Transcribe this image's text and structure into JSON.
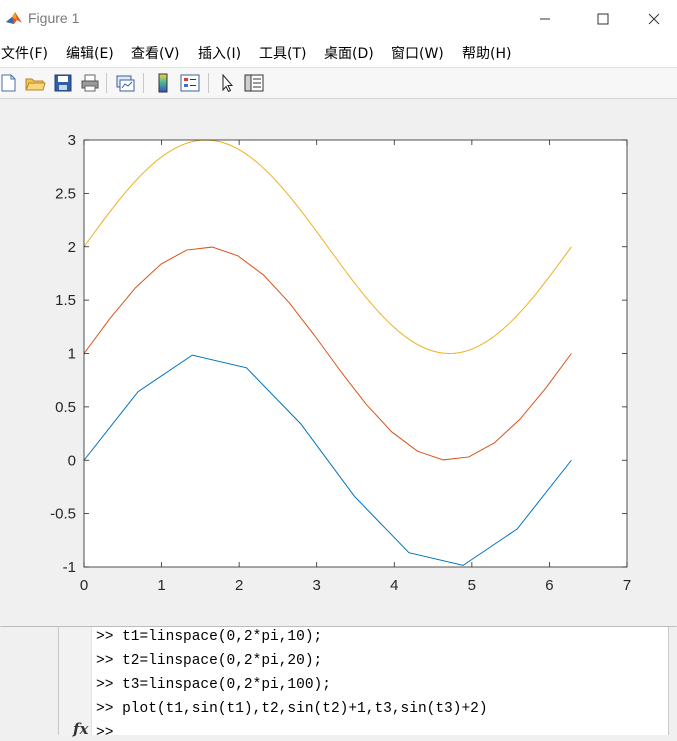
{
  "window": {
    "title": "Figure 1",
    "minimize_glyph": "—",
    "maximize_glyph": "☐",
    "close_glyph": "✕"
  },
  "menu": {
    "items": [
      {
        "label": "文件(F)"
      },
      {
        "label": "编辑(E)"
      },
      {
        "label": "查看(V)"
      },
      {
        "label": "插入(I)"
      },
      {
        "label": "工具(T)"
      },
      {
        "label": "桌面(D)"
      },
      {
        "label": "窗口(W)"
      },
      {
        "label": "帮助(H)"
      }
    ]
  },
  "toolbar": {
    "icons": [
      "new-figure-icon",
      "open-file-icon",
      "save-icon",
      "print-icon",
      "link-plot-icon",
      "insert-colorbar-icon",
      "insert-legend-icon",
      "edit-plot-pointer-icon",
      "property-inspector-icon"
    ]
  },
  "chart_data": {
    "type": "line",
    "xlim": [
      0,
      7
    ],
    "ylim": [
      -1,
      3
    ],
    "xticks": [
      0,
      1,
      2,
      3,
      4,
      5,
      6,
      7
    ],
    "yticks": [
      -1,
      -0.5,
      0,
      0.5,
      1,
      1.5,
      2,
      2.5,
      3
    ],
    "xtick_labels": [
      "0",
      "1",
      "2",
      "3",
      "4",
      "5",
      "6",
      "7"
    ],
    "ytick_labels": [
      "-1",
      "-0.5",
      "0",
      "0.5",
      "1",
      "1.5",
      "2",
      "2.5",
      "3"
    ],
    "grid": false,
    "series": [
      {
        "color": "#0072BD",
        "x": [
          0,
          0.698,
          1.396,
          2.094,
          2.793,
          3.491,
          4.189,
          4.887,
          5.585,
          6.283
        ],
        "y": [
          0,
          0.643,
          0.985,
          0.866,
          0.342,
          -0.342,
          -0.866,
          -0.985,
          -0.643,
          0
        ]
      },
      {
        "color": "#D95319",
        "x": [
          0,
          0.331,
          0.661,
          0.992,
          1.323,
          1.653,
          1.984,
          2.315,
          2.645,
          2.976,
          3.307,
          3.638,
          3.968,
          4.299,
          4.63,
          4.96,
          5.291,
          5.622,
          5.952,
          6.283
        ],
        "y": [
          1,
          1.325,
          1.614,
          1.837,
          1.969,
          1.997,
          1.915,
          1.735,
          1.476,
          1.165,
          0.835,
          0.524,
          0.265,
          0.085,
          0.003,
          0.031,
          0.163,
          0.386,
          0.675,
          1
        ]
      },
      {
        "color": "#EDB120",
        "function": "sin(x)+2",
        "x_range": [
          0,
          6.283
        ],
        "samples": 100
      }
    ]
  },
  "command_window": {
    "lines": [
      ">> t1=linspace(0,2*pi,10);",
      ">> t2=linspace(0,2*pi,20);",
      ">> t3=linspace(0,2*pi,100);",
      ">> plot(t1,sin(t1),t2,sin(t2)+1,t3,sin(t3)+2)",
      ">> "
    ],
    "fx_label": "fx"
  }
}
